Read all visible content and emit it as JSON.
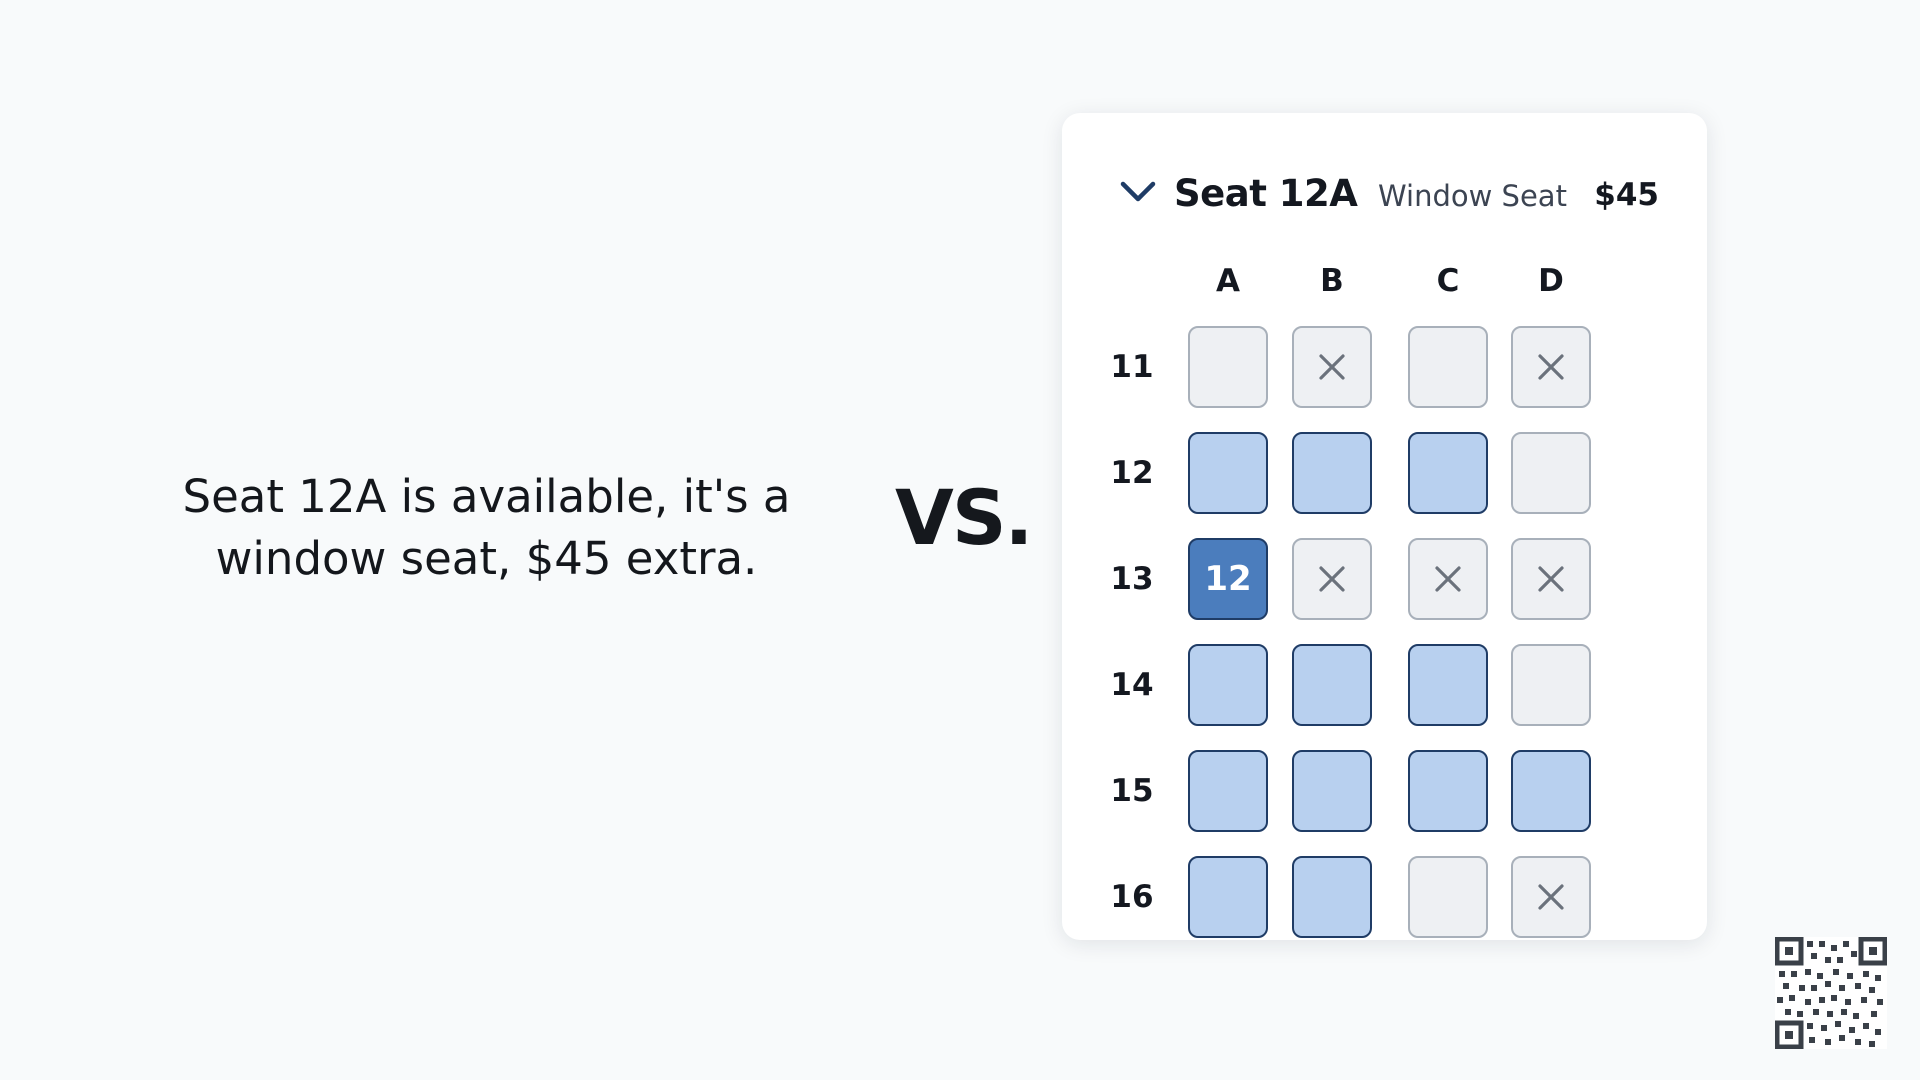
{
  "statement": {
    "line1": "Seat 12A is available, it's a",
    "line2": "window seat, $45 extra."
  },
  "vs_label": "VS.",
  "panel": {
    "chevron_icon": "chevron-down-icon",
    "seat_title": "Seat 12A",
    "seat_type": "Window Seat",
    "price": "$45"
  },
  "seat_map": {
    "columns": [
      "A",
      "B",
      "C",
      "D"
    ],
    "rows": [
      {
        "label": "11",
        "seats": [
          {
            "state": "empty"
          },
          {
            "state": "occupied"
          },
          {
            "state": "empty"
          },
          {
            "state": "occupied"
          }
        ]
      },
      {
        "label": "12",
        "seats": [
          {
            "state": "available"
          },
          {
            "state": "available"
          },
          {
            "state": "available"
          },
          {
            "state": "empty"
          }
        ]
      },
      {
        "label": "13",
        "seats": [
          {
            "state": "selected",
            "text": "12"
          },
          {
            "state": "occupied"
          },
          {
            "state": "occupied"
          },
          {
            "state": "occupied"
          }
        ]
      },
      {
        "label": "14",
        "seats": [
          {
            "state": "available"
          },
          {
            "state": "available"
          },
          {
            "state": "available"
          },
          {
            "state": "empty"
          }
        ]
      },
      {
        "label": "15",
        "seats": [
          {
            "state": "available"
          },
          {
            "state": "available"
          },
          {
            "state": "available"
          },
          {
            "state": "available"
          }
        ]
      },
      {
        "label": "16",
        "seats": [
          {
            "state": "available"
          },
          {
            "state": "available"
          },
          {
            "state": "empty"
          },
          {
            "state": "occupied"
          }
        ]
      }
    ]
  },
  "colors": {
    "available_fill": "#b8d0ef",
    "selected_fill": "#4b7dbd",
    "seat_border_dark": "#1f3c66",
    "empty_fill": "#eef0f3",
    "chevron": "#1f3c66"
  },
  "qr_icon": "qr-code-icon"
}
